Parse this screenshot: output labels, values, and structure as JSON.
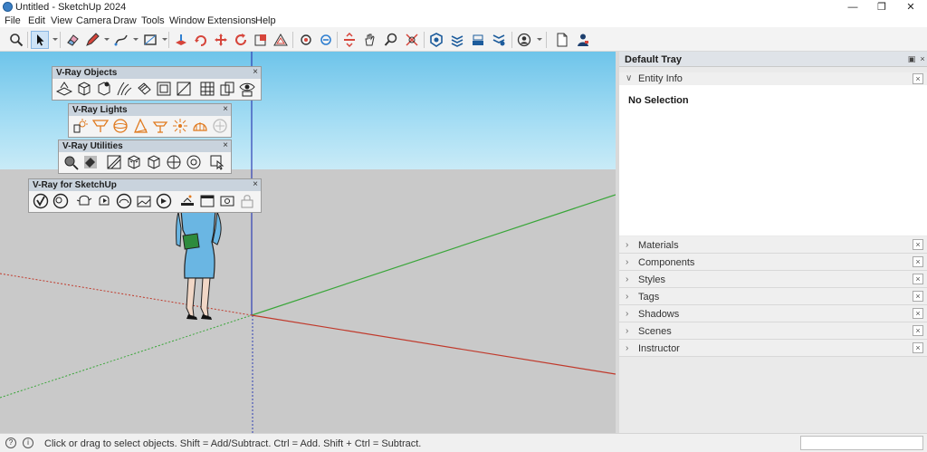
{
  "window": {
    "title": "Untitled - SketchUp 2024",
    "minimize": "—",
    "restore": "❐",
    "close": "✕"
  },
  "menu": [
    "File",
    "Edit",
    "View",
    "Camera",
    "Draw",
    "Tools",
    "Window",
    "Extensions",
    "Help"
  ],
  "toolbar_icons": [
    "search-icon",
    "select-arrow-icon",
    "eraser-icon",
    "pencil-icon",
    "line-icon",
    "rectangle-icon",
    "push-pull-icon",
    "rotate-icon",
    "move-icon",
    "refresh-icon",
    "scale-icon",
    "offset-icon",
    "orbit-icon",
    "pan-icon",
    "section-icon",
    "hand-icon",
    "zoom-icon",
    "zoom-extents-icon",
    "warehouse-icon",
    "extension-icon",
    "layers-icon",
    "settings-icon",
    "account-icon",
    "new-file-icon",
    "user-icon"
  ],
  "floating_toolbars": [
    {
      "title": "V-Ray Objects",
      "close": "×"
    },
    {
      "title": "V-Ray Lights",
      "close": "×"
    },
    {
      "title": "V-Ray Utilities",
      "close": "×"
    },
    {
      "title": "V-Ray for SketchUp",
      "close": "×"
    }
  ],
  "tray": {
    "title": "Default Tray",
    "pin": "▣",
    "close": "×",
    "entity_info": {
      "label": "Entity Info",
      "close": "×",
      "body": "No Selection"
    },
    "panels": [
      {
        "label": "Materials",
        "close": "×"
      },
      {
        "label": "Components",
        "close": "×"
      },
      {
        "label": "Styles",
        "close": "×"
      },
      {
        "label": "Tags",
        "close": "×"
      },
      {
        "label": "Shadows",
        "close": "×"
      },
      {
        "label": "Scenes",
        "close": "×"
      },
      {
        "label": "Instructor",
        "close": "×"
      }
    ]
  },
  "status": {
    "text": "Click or drag to select objects. Shift = Add/Subtract. Ctrl = Add. Shift + Ctrl = Subtract.",
    "icon1": "?",
    "icon2": "i"
  },
  "colors": {
    "sky": "#6ec4ea",
    "ground": "#c9c9c9",
    "axis_red": "#c0392b",
    "axis_green": "#3aa63a",
    "axis_blue": "#2f3fb3",
    "vray_orange": "#e07a1f"
  }
}
